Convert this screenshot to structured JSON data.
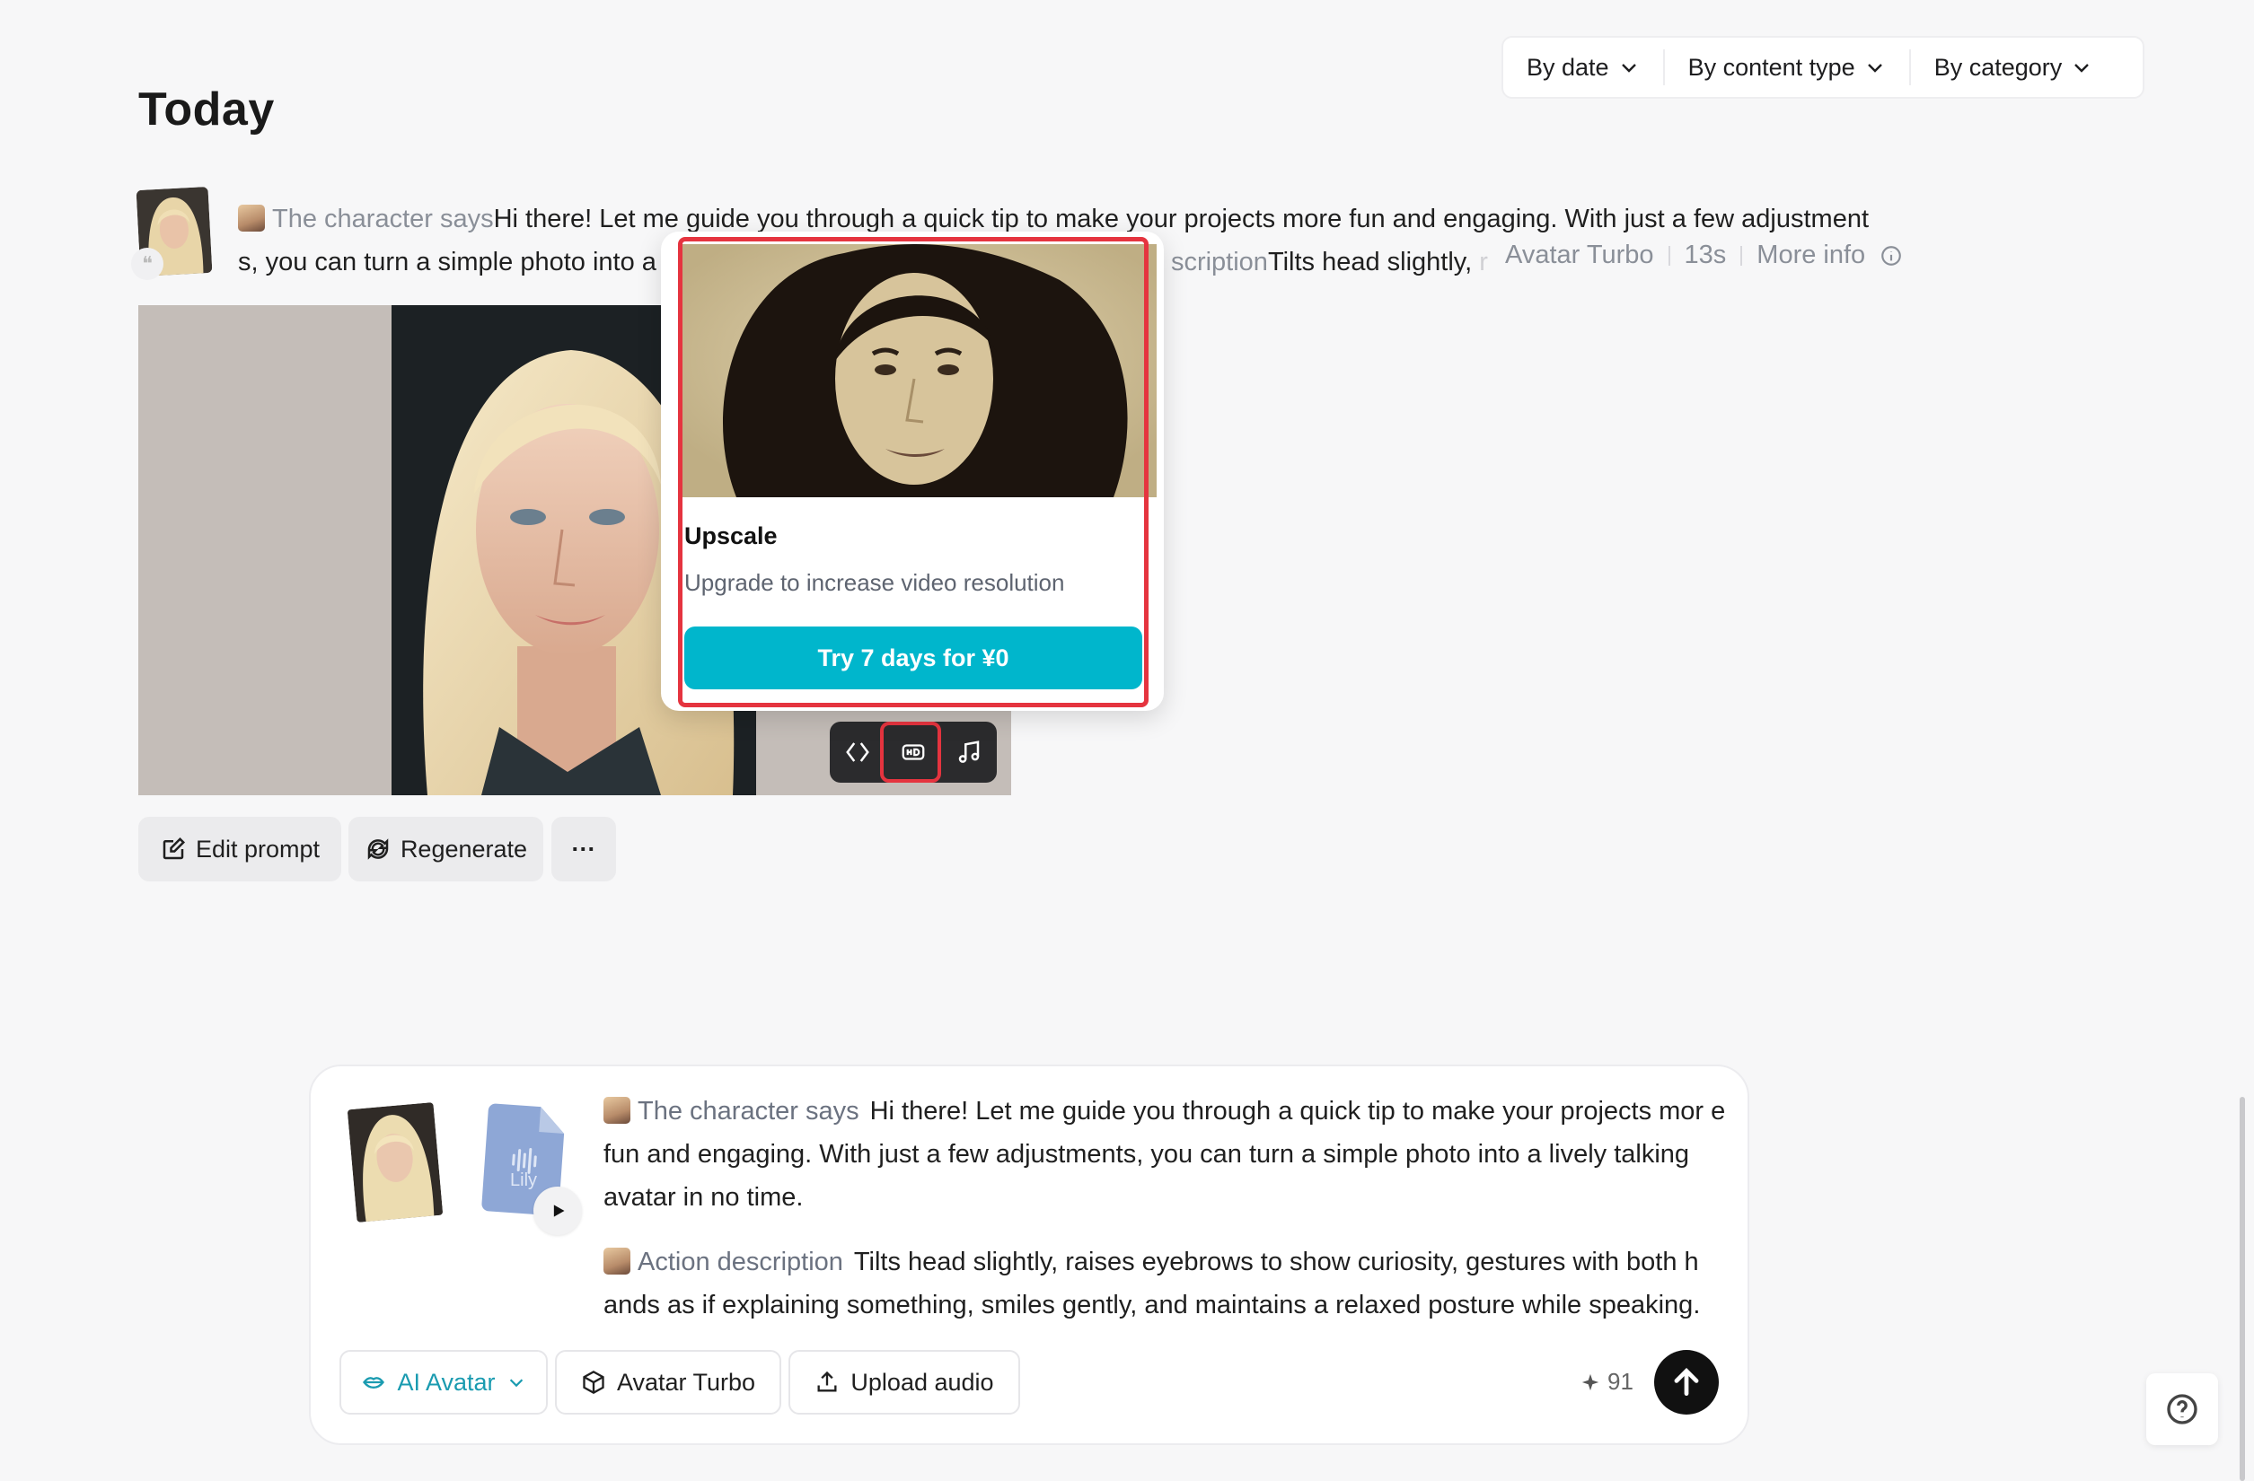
{
  "filters": [
    {
      "label": "By date"
    },
    {
      "label": "By content type"
    },
    {
      "label": "By category"
    }
  ],
  "section_title": "Today",
  "prompt": {
    "character_tag": "The character says",
    "line1": "Hi there! Let me guide you through a quick tip to make your projects more fun and engaging. With just a few adjustment",
    "line2_start": "s, you can turn a simple photo into a",
    "line2_end": "scription",
    "action_fragment": "Tilts head slightly,",
    "action_fade": "r"
  },
  "meta": {
    "model": "Avatar Turbo",
    "duration": "13s",
    "more_info": "More info"
  },
  "popover": {
    "title": "Upscale",
    "description": "Upgrade to increase video resolution",
    "cta": "Try 7 days for ¥0"
  },
  "video_tools": [
    "code-icon",
    "hd-icon",
    "music-icon"
  ],
  "actions": {
    "edit_prompt": "Edit prompt",
    "regenerate": "Regenerate",
    "more": "···"
  },
  "composer": {
    "voice_name": "Lily",
    "character_tag": "The character says",
    "character_text": "Hi there! Let me guide you through a quick tip to make your projects mor e fun and engaging. With just a few adjustments, you can turn a simple photo into a lively talking avatar in no time.",
    "action_tag": "Action description",
    "action_text": "Tilts head slightly, raises eyebrows to show curiosity, gestures with both h ands as if explaining something, smiles gently, and maintains a relaxed posture while speaking.",
    "mode": "AI Avatar",
    "model": "Avatar Turbo",
    "upload": "Upload audio",
    "credits": "91"
  },
  "colors": {
    "accent": "#00b6cc",
    "highlight": "#e5343f",
    "mode_text": "#1a9bb0"
  }
}
